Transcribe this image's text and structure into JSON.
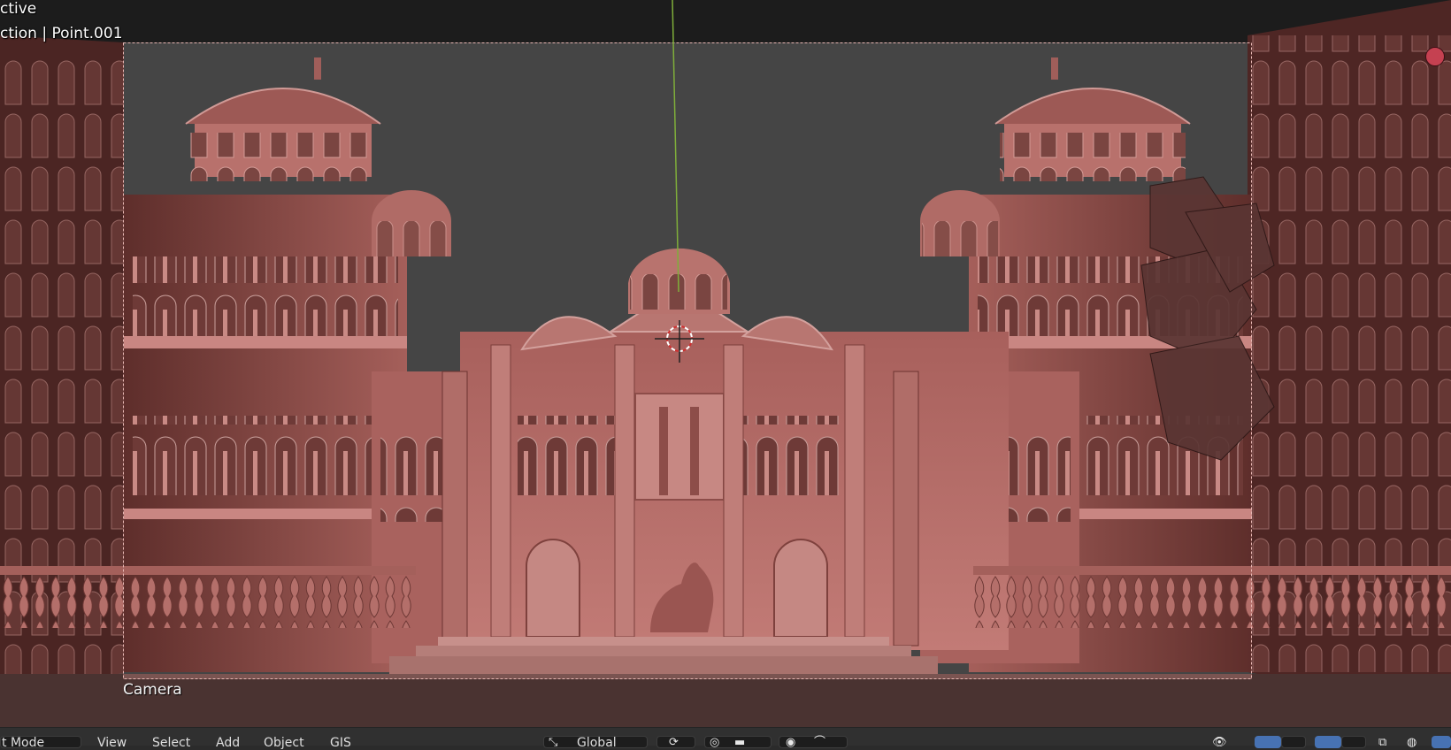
{
  "viewport": {
    "info_line_1": "ctive",
    "info_line_2": "ction | Point.001",
    "camera_label": "Camera",
    "recording_indicator": "record-dot-icon"
  },
  "header": {
    "mode_label": "t Mode",
    "menu": {
      "view": "View",
      "select": "Select",
      "add": "Add",
      "object": "Object",
      "gis": "GIS"
    },
    "orientation_label": "Global"
  },
  "colors": {
    "sky": "#464646",
    "stone": "#b06a67",
    "stone_shadow": "#7a3f3c",
    "y_axis": "#7fae3a",
    "record": "#c54151",
    "active_button": "#4772b3"
  }
}
